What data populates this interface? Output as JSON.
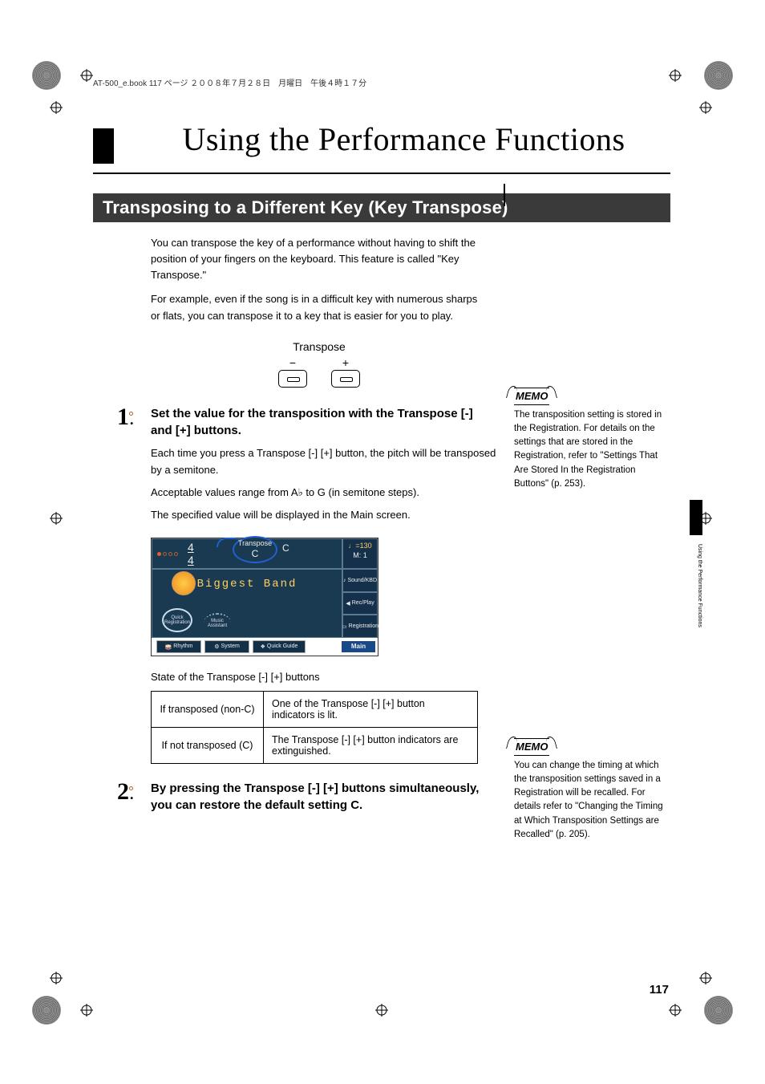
{
  "header_line": "AT-500_e.book  117 ページ  ２００８年７月２８日　月曜日　午後４時１７分",
  "chapter_title": "Using the Performance Functions",
  "section_title": "Transposing to a Different Key (Key Transpose)",
  "intro_p1": "You can transpose the key of a performance without having to shift the position of your fingers on the keyboard. This feature is called \"Key Transpose.\"",
  "intro_p2": "For example, even if the song is in a difficult key with numerous sharps or flats, you can transpose it to a key that is easier for you to play.",
  "transpose_fig": {
    "label": "Transpose",
    "minus": "−",
    "plus": "+"
  },
  "step1": {
    "num": "1",
    "head": "Set the value for the transposition with the Transpose [-] and [+] buttons.",
    "p1": "Each time you press a Transpose [-] [+] button, the pitch will be transposed by a semitone.",
    "p2_a": "Acceptable values range from A",
    "p2_flat": "♭",
    "p2_b": " to G (in semitone steps).",
    "p3": "The specified value will be displayed in the Main screen."
  },
  "screen": {
    "timesig": "4\n4",
    "callout_top": "Transpose",
    "callout_val": "C",
    "keylabel": "C",
    "tempo": "♩=130",
    "measure": "M:     1",
    "style": "Biggest Band",
    "badge_qr_top": "Quick",
    "badge_qr_bot": "Registration",
    "badge_ma_top": "Music",
    "badge_ma_bot": "Assistant",
    "side": {
      "sound": "Sound/KBD",
      "rec": "Rec/Play",
      "reg": "Registration"
    },
    "bot": {
      "rhythm": "Rhythm",
      "system": "System",
      "quick": "Quick Guide",
      "main": "Main"
    }
  },
  "table_caption": "State of the Transpose [-] [+] buttons",
  "table": {
    "r1c1": "If transposed (non-C)",
    "r1c2": "One of the Transpose [-] [+] button indicators is lit.",
    "r2c1": "If not transposed (C)",
    "r2c2": "The Transpose [-] [+] button indicators are extinguished."
  },
  "step2": {
    "num": "2",
    "head": "By pressing the Transpose [-] [+] buttons simultaneously, you can restore the default setting C."
  },
  "memo_label": "MEMO",
  "memo1": "The transposition setting is stored in the Registration. For details on the settings that are stored in the Registration, refer to \"Settings That Are Stored In the Registration Buttons\" (p. 253).",
  "memo2": "You can change the timing at which the transposition settings saved in a Registration will be recalled. For details refer to \"Changing the Timing at Which Transposition Settings are Recalled\" (p. 205).",
  "side_tab": "Using the Performance Functions",
  "page_number": "117"
}
